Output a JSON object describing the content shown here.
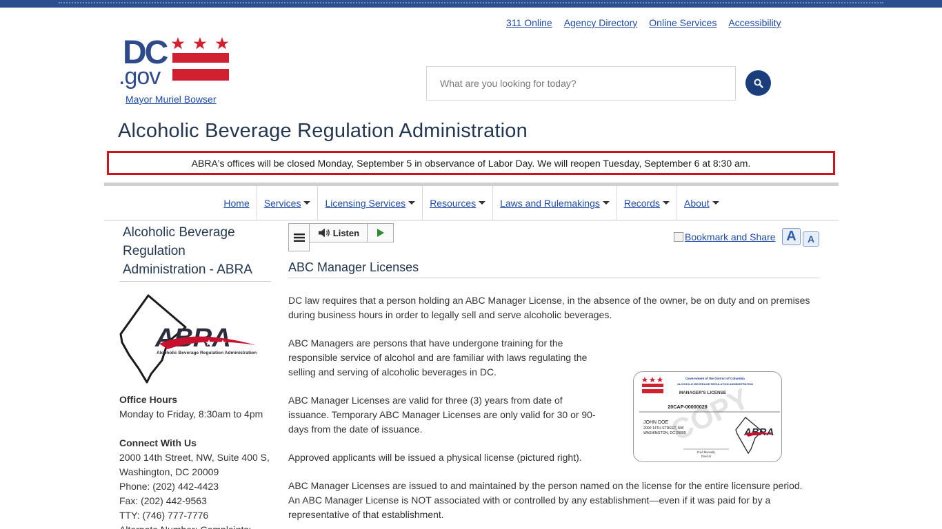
{
  "utility_links": [
    "311 Online",
    "Agency Directory",
    "Online Services",
    "Accessibility"
  ],
  "logo": {
    "text": "DC.gov",
    "colors": {
      "blue": "#2f4a8a",
      "red": "#d1202f"
    }
  },
  "mayor_link": "Mayor Muriel Bowser",
  "search": {
    "placeholder": "What are you looking for today?",
    "button_icon": "search-icon"
  },
  "agency_title": "Alcoholic Beverage Regulation Administration",
  "alert": "ABRA's offices will be closed Monday, September 5 in observance of Labor Day. We will reopen Tuesday, September 6 at 8:30 am.",
  "nav": [
    {
      "label": "Home",
      "dropdown": false
    },
    {
      "label": "Services",
      "dropdown": true
    },
    {
      "label": "Licensing Services",
      "dropdown": true
    },
    {
      "label": "Resources",
      "dropdown": true
    },
    {
      "label": "Laws and Rulemakings",
      "dropdown": true
    },
    {
      "label": "Records",
      "dropdown": true
    },
    {
      "label": "About",
      "dropdown": true
    }
  ],
  "sidebar": {
    "title": "Alcoholic Beverage Regulation Administration - ABRA",
    "abra_logo": {
      "text": "ABRA",
      "caption": "Alcoholic Beverage Regulation Administration"
    },
    "office_hours_heading": "Office Hours",
    "office_hours": "Monday to Friday, 8:30am to 4pm",
    "connect_heading": "Connect With Us",
    "address_line1": "2000 14th Street, NW, Suite 400 S,",
    "address_line2": "Washington, DC 20009",
    "phone": "Phone: (202) 442-4423",
    "fax": "Fax: (202) 442-9563",
    "tty": "TTY: (746) 777-7776",
    "alternate": "Alternate Number: Complaints:"
  },
  "toolbar": {
    "listen_label": "Listen",
    "bookmark_label": "Bookmark and Share",
    "font_large": "A",
    "font_small": "A"
  },
  "content": {
    "heading": "ABC Manager Licenses",
    "p1": "DC law requires that a person holding an ABC Manager License, in the absence of the owner, be on duty and on premises during business hours in order to legally sell and serve alcoholic beverages.",
    "p2": "ABC Managers are persons that have undergone training for the responsible service of alcohol and are familiar with laws regulating the selling and serving of alcoholic beverages in DC.",
    "p3": "ABC Manager Licenses are valid for three (3) years from date of issuance. Temporary ABC Manager Licenses are only valid for 30 or 90-days from the date of issuance.",
    "p4": "Approved applicants will be issued a physical license (pictured right).",
    "p5": "ABC Manager Licenses are issued to and maintained by the person named on the license for the entire licensure period. An ABC Manager License is NOT associated with or controlled by any establishment—even if it was paid for by a representative of that establishment."
  },
  "license_card": {
    "gov_line": "Government of the District of Columbia",
    "agency_line": "ALCOHOLIC BEVERAGE REGULATION ADMINISTRATION",
    "title": "MANAGER'S LICENSE",
    "number": "20CAP-00000028",
    "name": "JOHN DOE",
    "street": "2000 14TH STREET, NW",
    "city": "WASHINGTON, DC 20009",
    "watermark": "COPY",
    "signer": "Fred Moosally",
    "signer_title": "Director",
    "logo_text": "ABRA"
  }
}
